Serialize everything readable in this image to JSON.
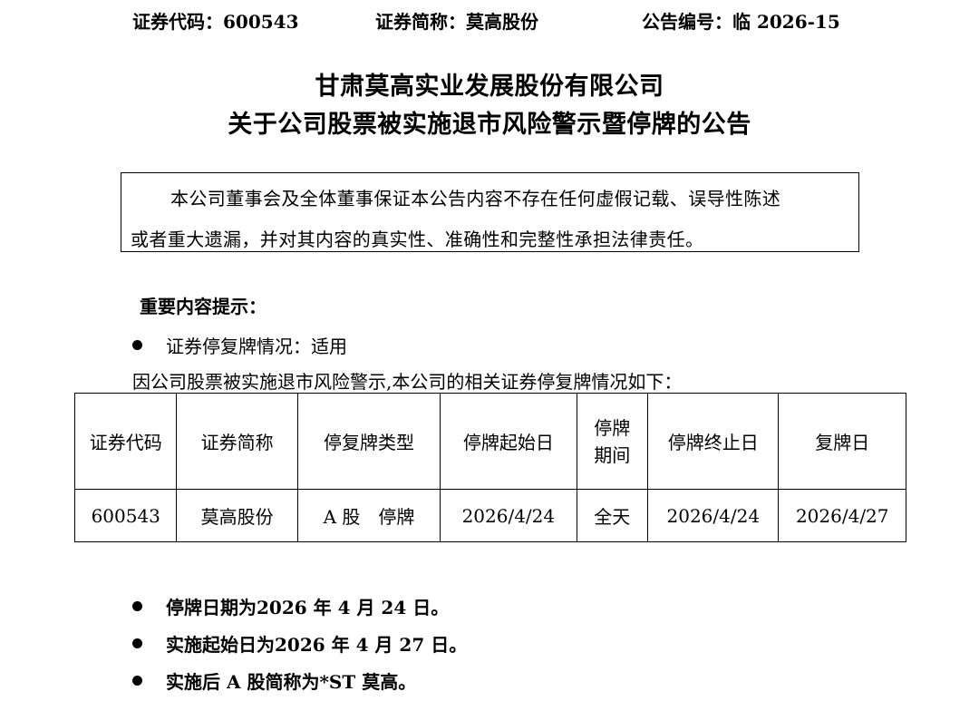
{
  "header": {
    "code": "证券代码：600543",
    "short_name": "证券简称：莫高股份",
    "notice_no": "公告编号：临 2026-15"
  },
  "title": {
    "line1": "甘肃莫高实业发展股份有限公司",
    "line2": "关于公司股票被实施退市风险警示暨停牌的公告"
  },
  "notice_box": {
    "line1": "本公司董事会及全体董事保证本公告内容不存在任何虚假记载、误导性陈述",
    "line2": "或者重大遗漏，并对其内容的真实性、准确性和完整性承担法律责任。"
  },
  "key_points": {
    "title": "重要内容提示：",
    "bullet1": "证券停复牌情况：适用",
    "intro": "因公司股票被实施退市风险警示,本公司的相关证券停复牌情况如下："
  },
  "table": {
    "headers": [
      "证券代码",
      "证券简称",
      "停复牌类型",
      "停牌起始日",
      "停牌期间",
      "停牌终止日",
      "复牌日"
    ],
    "rows": [
      [
        "600543",
        "莫高股份",
        "A 股　停牌",
        "2026/4/24",
        "全天",
        "2026/4/24",
        "2026/4/27"
      ]
    ]
  },
  "bullets": [
    "停牌日期为2026 年 4 月 24 日。",
    "实施起始日为2026 年 4 月 27 日。",
    "实施后 A 股简称为*ST 莫高。"
  ]
}
